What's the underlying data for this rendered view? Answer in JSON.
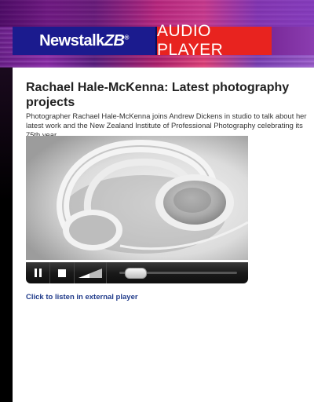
{
  "header": {
    "logo_prefix": "Newstalk",
    "logo_suffix": "ZB",
    "logo_reg": "®",
    "section_title": "AUDIO PLAYER"
  },
  "article": {
    "title": "Rachael Hale-McKenna: Latest photography projects",
    "description": "Photographer Rachael Hale-McKenna joins Andrew Dickens in studio to talk about her latest work and the New Zealand Institute of Professional Photography celebrating its 75th year"
  },
  "player": {
    "play_state": "playing",
    "progress": 0.06
  },
  "links": {
    "external_player": "Click to listen in external player"
  },
  "colors": {
    "brand_blue": "#1b1b8e",
    "brand_red": "#e8231f",
    "link": "#1f3a8a"
  },
  "icons": [
    "pause-icon",
    "stop-icon",
    "volume-icon",
    "seek-knob"
  ]
}
